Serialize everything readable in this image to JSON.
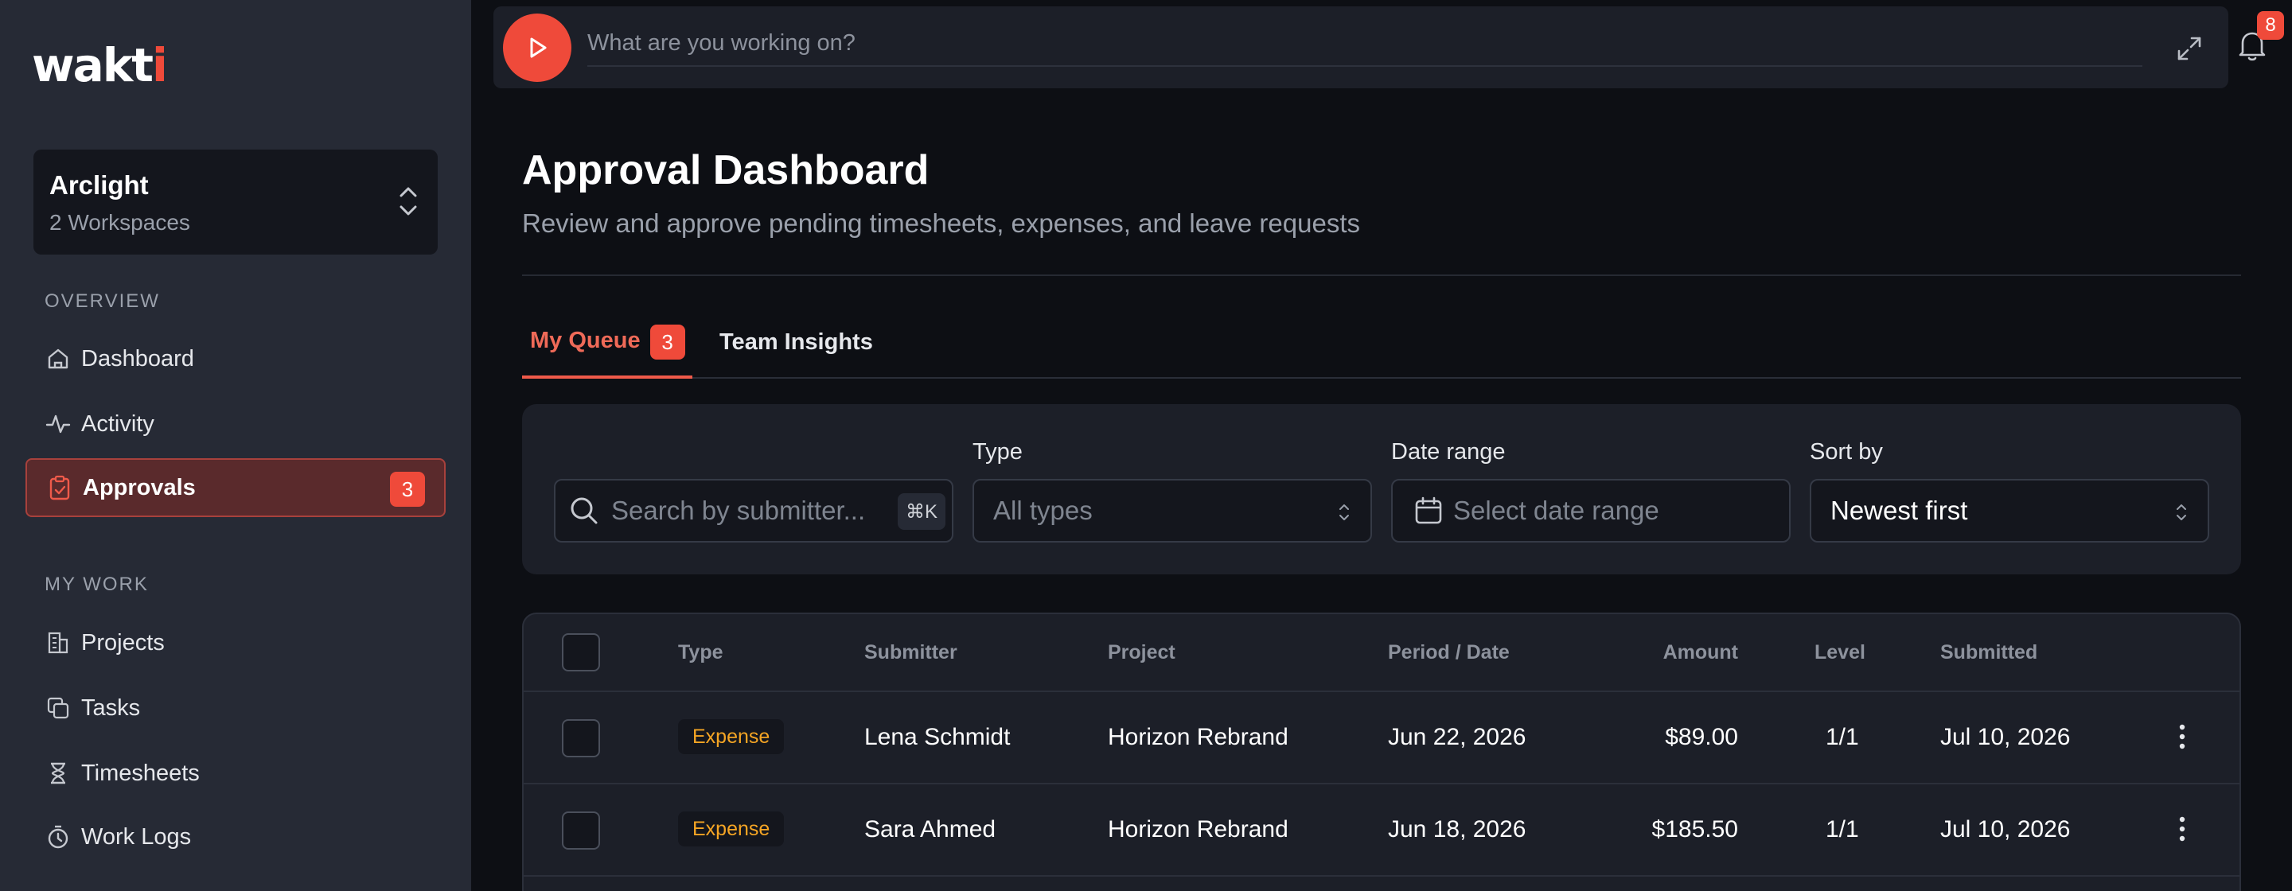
{
  "brand": {
    "logo_text": "wakti"
  },
  "workspace": {
    "name": "Arclight",
    "count": "2 Workspaces"
  },
  "sidebar": {
    "sections": [
      {
        "label": "OVERVIEW"
      },
      {
        "label": "MY WORK"
      }
    ],
    "items": [
      {
        "label": "Dashboard",
        "icon": "home-icon"
      },
      {
        "label": "Activity",
        "icon": "activity-icon"
      },
      {
        "label": "Approvals",
        "icon": "clipboard-check-icon",
        "badge": "3",
        "active": true
      },
      {
        "label": "Projects",
        "icon": "building-icon"
      },
      {
        "label": "Tasks",
        "icon": "copy-icon"
      },
      {
        "label": "Timesheets",
        "icon": "hourglass-icon"
      },
      {
        "label": "Work Logs",
        "icon": "timer-icon"
      }
    ]
  },
  "timer": {
    "placeholder": "What are you working on?"
  },
  "notifications": {
    "count": "8"
  },
  "page": {
    "title": "Approval Dashboard",
    "subtitle": "Review and approve pending timesheets, expenses, and leave requests"
  },
  "tabs": [
    {
      "label": "My Queue",
      "badge": "3",
      "active": true
    },
    {
      "label": "Team Insights"
    }
  ],
  "filters": {
    "search": {
      "placeholder": "Search by submitter...",
      "shortcut": "⌘K"
    },
    "type": {
      "label": "Type",
      "placeholder": "All types"
    },
    "date_range": {
      "label": "Date range",
      "placeholder": "Select date range"
    },
    "sort": {
      "label": "Sort by",
      "value": "Newest first"
    }
  },
  "table": {
    "columns": [
      "Type",
      "Submitter",
      "Project",
      "Period / Date",
      "Amount",
      "Level",
      "Submitted"
    ],
    "rows": [
      {
        "type": "Expense",
        "submitter": "Lena Schmidt",
        "project": "Horizon Rebrand",
        "period": "Jun 22, 2026",
        "amount": "$89.00",
        "level": "1/1",
        "submitted": "Jul 10, 2026"
      },
      {
        "type": "Expense",
        "submitter": "Sara Ahmed",
        "project": "Horizon Rebrand",
        "period": "Jun 18, 2026",
        "amount": "$185.50",
        "level": "1/1",
        "submitted": "Jul 10, 2026"
      }
    ]
  },
  "colors": {
    "accent": "#ef4a3a",
    "expense": "#f5a524",
    "sidebar_bg": "#262a35",
    "page_bg": "#0d0f14"
  }
}
